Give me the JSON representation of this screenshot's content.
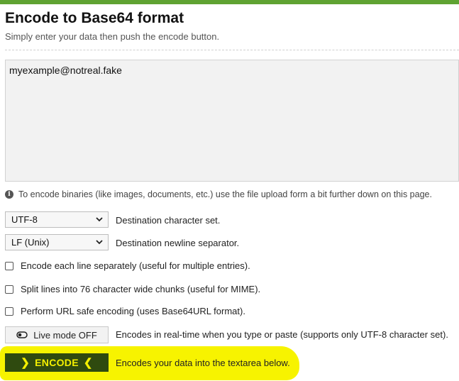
{
  "header": {
    "title": "Encode to Base64 format",
    "subtitle": "Simply enter your data then push the encode button."
  },
  "input": {
    "value": "myexample@notreal.fake"
  },
  "info": {
    "icon": "info-icon",
    "text": "To encode binaries (like images, documents, etc.) use the file upload form a bit further down on this page."
  },
  "charset": {
    "selected": "UTF-8",
    "label": "Destination character set."
  },
  "newline": {
    "selected": "LF (Unix)",
    "label": "Destination newline separator."
  },
  "options": {
    "each_line": "Encode each line separately (useful for multiple entries).",
    "split_lines": "Split lines into 76 character wide chunks (useful for MIME).",
    "url_safe": "Perform URL safe encoding (uses Base64URL format)."
  },
  "live_mode": {
    "button_label": "Live mode OFF",
    "description": "Encodes in real-time when you type or paste (supports only UTF-8 character set)."
  },
  "encode": {
    "button_label": "ENCODE",
    "description": "Encodes your data into the textarea below."
  },
  "colors": {
    "accent_green": "#5fa332",
    "encode_bg": "#2f4a0f",
    "encode_text": "#f4f000",
    "highlight": "#f7f300"
  }
}
